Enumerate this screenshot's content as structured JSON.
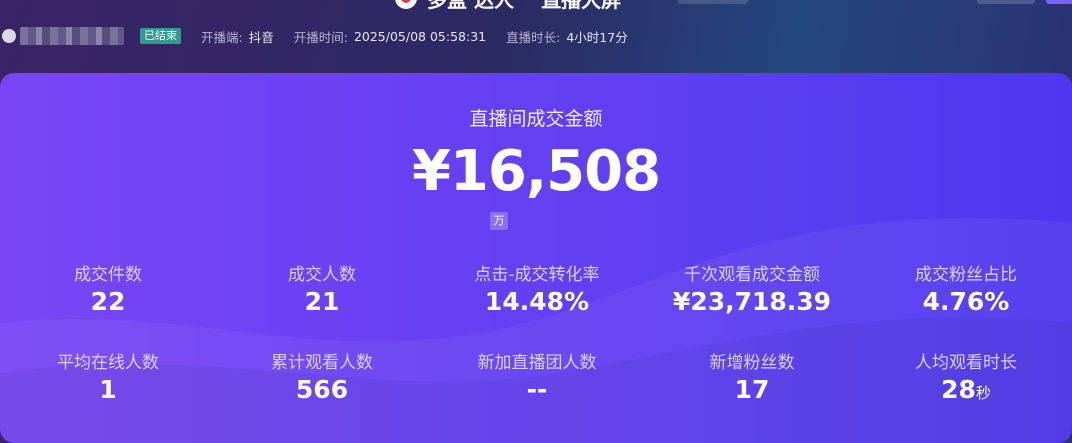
{
  "header": {
    "title_left": "多盒 达人",
    "title_sep": "-",
    "title_right": "直播大屏"
  },
  "meta": {
    "status_badge": "已结束",
    "platform_label": "开播端:",
    "platform_value": "抖音",
    "start_label": "开播时间:",
    "start_value": "2025/05/08 05:58:31",
    "duration_label": "直播时长:",
    "duration_value": "4小时17分"
  },
  "summary": {
    "label": "直播间成交金额",
    "value": "¥16,508",
    "unit_badge": "万"
  },
  "stats": [
    {
      "label": "成交件数",
      "value": "22",
      "unit": ""
    },
    {
      "label": "成交人数",
      "value": "21",
      "unit": ""
    },
    {
      "label": "点击-成交转化率",
      "value": "14.48%",
      "unit": ""
    },
    {
      "label": "千次观看成交金额",
      "value": "¥23,718.39",
      "unit": ""
    },
    {
      "label": "成交粉丝占比",
      "value": "4.76%",
      "unit": ""
    },
    {
      "label": "平均在线人数",
      "value": "1",
      "unit": ""
    },
    {
      "label": "累计观看人数",
      "value": "566",
      "unit": ""
    },
    {
      "label": "新加直播团人数",
      "value": "--",
      "unit": ""
    },
    {
      "label": "新增粉丝数",
      "value": "17",
      "unit": ""
    },
    {
      "label": "人均观看时长",
      "value": "28",
      "unit": "秒"
    }
  ],
  "colors": {
    "badge_green": "#2f9c8e",
    "panel_start": "#7a46f5",
    "panel_end": "#4e37ee"
  }
}
